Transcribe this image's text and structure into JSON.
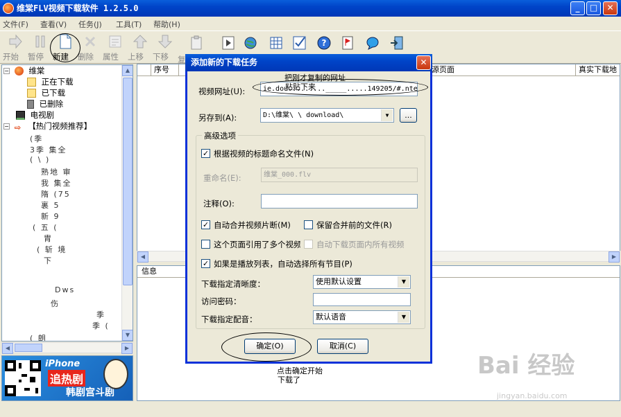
{
  "window": {
    "title": "维棠FLV视频下载软件 1.2.5.0",
    "min": "_",
    "max": "□",
    "close": "✕"
  },
  "menu": [
    "文件(F)",
    "查看(V)",
    "任务(J)",
    "工具(T)",
    "帮助(H)"
  ],
  "toolbar": [
    "开始",
    "暂停",
    "新建",
    "删除",
    "属性",
    "上移",
    "下移",
    "复"
  ],
  "tree": {
    "root": "维棠",
    "downloading": "正在下载",
    "downloaded": "已下载",
    "deleted": "已删除",
    "tv": "电视剧",
    "hot": "【热门视频推荐】"
  },
  "tree_blurred": [
    "(季",
    "3季  集全",
    "(  \\  )",
    "熟地  审",
    "我  集全",
    "隋  (75",
    "裏  5",
    "新  9",
    "(  五  (",
    "胄  ",
    "(  斩  境",
    "  下  ",
    "  ",
    "Dws  ",
    "伤  ",
    "季",
    "季  (",
    "(  朗  "
  ],
  "banner": {
    "line1": "iPhone",
    "line2": "追热剧",
    "line3": "韩剧宫斗剧"
  },
  "grid_headers": [
    "序号",
    "",
    "源页面",
    "真实下载地"
  ],
  "info_header": "信息",
  "dialog": {
    "title": "添加新的下载任务",
    "url_label": "视频网址(U):",
    "url_value": "ie.dou........._____.....149205/#.ntent",
    "save_label": "另存到(A):",
    "save_value": "D:\\维棠\\  \\  download\\",
    "browse": "...",
    "advanced": "高级选项",
    "name_by_title": "根据视频的标题命名文件(N)",
    "rename_label": "重命名(E):",
    "rename_value": "维棠_000.flv",
    "comment_label": "注释(O):",
    "comment_value": "",
    "auto_merge": "自动合并视频片断(M)",
    "keep_before": "保留合并前的文件(R)",
    "multi_video": "这个页面引用了多个视频",
    "auto_all": "自动下载页面内所有视频",
    "playlist": "如果是播放列表，自动选择所有节目(P)",
    "clarity_label": "下载指定清晰度：",
    "clarity_value": "使用默认设置",
    "password_label": "访问密码：",
    "password_value": "",
    "audio_label": "下载指定配音：",
    "audio_value": "默认语音",
    "ok": "确定(O)",
    "cancel": "取消(C)"
  },
  "annotations": {
    "copy_note": "把刚才复制的网址",
    "paste_note": "粘贴下来",
    "click_note_1": "点击确定开始",
    "click_note_2": "下载了"
  },
  "watermark": {
    "main": "Bai 经验",
    "sub": "jingyan.baidu.com"
  }
}
